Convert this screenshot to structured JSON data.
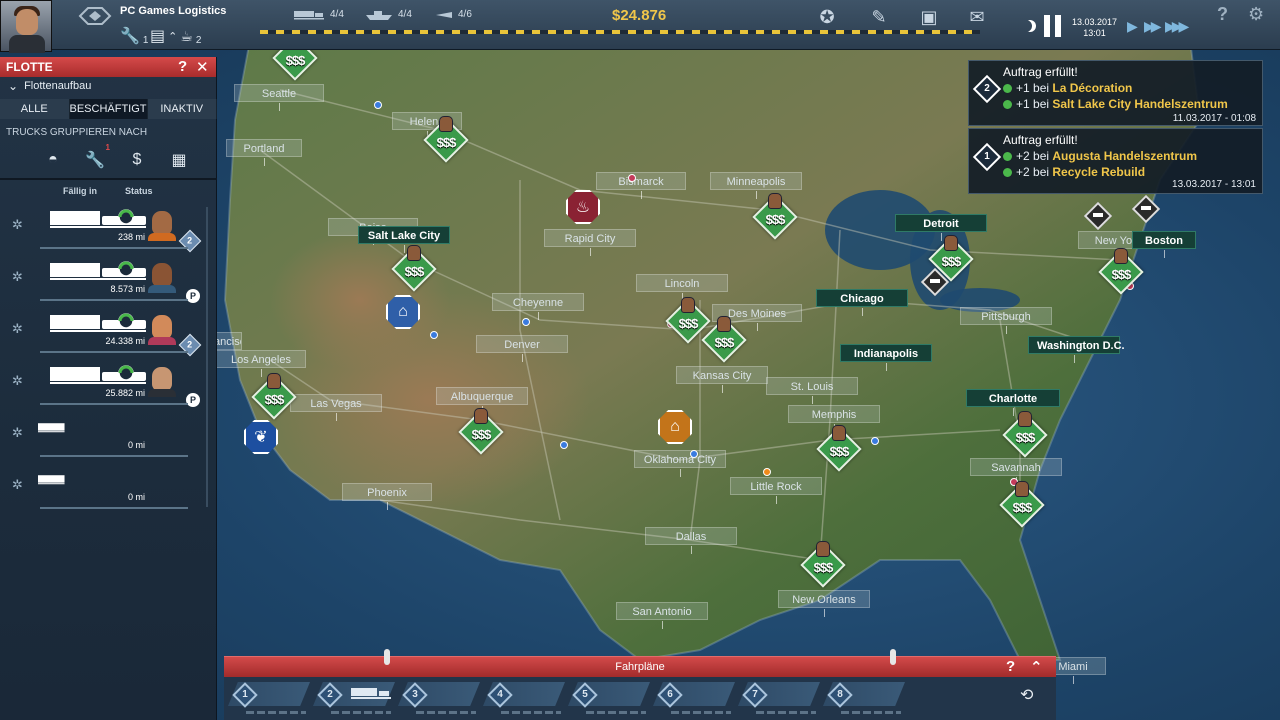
{
  "topbar": {
    "company_name": "PC Games Logistics",
    "trucks_stat": "1",
    "fleet_stat": "2",
    "count_trucks": "4/4",
    "count_ships": "4/4",
    "count_planes": "4/6",
    "balance": "$24.876",
    "date": "13.03.2017",
    "time": "13:01",
    "help": "?",
    "accent_color": "#f0c64a"
  },
  "fleet": {
    "title": "FLOTTE",
    "help": "?",
    "close": "✕",
    "subheader": "Flottenaufbau",
    "tabs": [
      "ALLE",
      "BESCHÄFTIGT",
      "INAKTIV"
    ],
    "group_label": "TRUCKS GRUPPIEREN NACH",
    "group_badge": "1",
    "col_due": "Fällig in",
    "col_status": "Status",
    "rows": [
      {
        "mi": "238 mi",
        "status": "2"
      },
      {
        "mi": "8.573 mi",
        "status": "P"
      },
      {
        "mi": "24.338 mi",
        "status": "2"
      },
      {
        "mi": "25.882 mi",
        "status": "P"
      },
      {
        "mi": "0 mi"
      },
      {
        "mi": "0 mi"
      }
    ]
  },
  "notifications": [
    {
      "title": "Auftrag erfüllt!",
      "badge": "2",
      "line1_prefix": "+1 bei ",
      "line1_name": "La Décoration",
      "line2_prefix": "+1 bei ",
      "line2_name": "Salt Lake City Handelszentrum",
      "timestamp": "11.03.2017 - 01:08"
    },
    {
      "title": "Auftrag erfüllt!",
      "badge": "1",
      "line1_prefix": "+2 bei ",
      "line1_name": "Augusta Handelszentrum",
      "line2_prefix": "+2 bei ",
      "line2_name": "Recycle Rebuild",
      "timestamp": "13.03.2017 - 13:01"
    }
  ],
  "map": {
    "cities": [
      "Seattle",
      "Helena",
      "Portland",
      "Boise",
      "Salt Lake City",
      "Bismarck",
      "Minneapolis",
      "Rapid City",
      "Detroit",
      "New York",
      "Boston",
      "Chicago",
      "Lincoln",
      "Des Moines",
      "Cheyenne",
      "Denver",
      "Pittsburgh",
      "Indianapolis",
      "Washington D.C.",
      "San Francisco",
      "Los Angeles",
      "Las Vegas",
      "Albuquerque",
      "Kansas City",
      "St. Louis",
      "Memphis",
      "Charlotte",
      "Savannah",
      "Oklahoma City",
      "Little Rock",
      "Phoenix",
      "Dallas",
      "San Antonio",
      "New Orleans",
      "Miami"
    ],
    "city_labels": {
      "seattle": "Seattle",
      "helena": "Helena",
      "portland": "Portland",
      "boise": "Boise",
      "salt_lake_city": "Salt Lake City",
      "bismarck": "Bismarck",
      "minneapolis": "Minneapolis",
      "rapid_city": "Rapid City",
      "detroit": "Detroit",
      "new_york": "New York",
      "boston": "Boston",
      "chicago": "Chicago",
      "lincoln": "Lincoln",
      "des_moines": "Des Moines",
      "cheyenne": "Cheyenne",
      "denver": "Denver",
      "pittsburgh": "Pittsburgh",
      "indianapolis": "Indianapolis",
      "washington": "Washington D.C.",
      "san_francisco": "San Francisco",
      "los_angeles": "Los Angeles",
      "las_vegas": "Las Vegas",
      "albuquerque": "Albuquerque",
      "kansas_city": "Kansas City",
      "st_louis": "St. Louis",
      "memphis": "Memphis",
      "charlotte": "Charlotte",
      "savannah": "Savannah",
      "oklahoma_city": "Oklahoma City",
      "little_rock": "Little Rock",
      "phoenix": "Phoenix",
      "dallas": "Dallas",
      "san_antonio": "San Antonio",
      "new_orleans": "New Orleans",
      "miami": "Miami"
    },
    "money_symbol": "$$$",
    "land_color": "#4d6a3a",
    "water_color": "#1d4468"
  },
  "schedules": {
    "title": "Fahrpläne",
    "help": "?",
    "collapse": "⌃",
    "slots": [
      "1",
      "2",
      "3",
      "4",
      "5",
      "6",
      "7",
      "8"
    ]
  }
}
